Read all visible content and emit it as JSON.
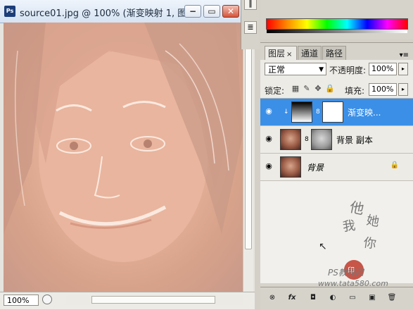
{
  "document": {
    "title": "source01.jpg @ 100% (渐变映射 1, 图...",
    "zoom": "100%",
    "app_icon": "Ps"
  },
  "window_buttons": {
    "minimize": "−",
    "restore": "▭",
    "close": "✕"
  },
  "layers_panel": {
    "tabs": [
      {
        "label": "图层",
        "close": "×"
      },
      {
        "label": "通道"
      },
      {
        "label": "路径"
      }
    ],
    "blend_mode": "正常",
    "opacity_label": "不透明度:",
    "opacity_value": "100%",
    "lock_label": "锁定:",
    "fill_label": "填充:",
    "fill_value": "100%",
    "layers": [
      {
        "name": "渐变映...",
        "selected": true
      },
      {
        "name": "背景 副本",
        "selected": false
      },
      {
        "name": "背景",
        "selected": false,
        "locked": true
      }
    ],
    "watermark_text": "他她我你",
    "site_text": "PS教程网",
    "url_text": "www.tata580.com"
  },
  "icons": {
    "eye": "eye-icon",
    "chain": "chain-link-icon",
    "lock": "lock-icon",
    "link": "link-layers-icon",
    "fx": "fx-icon",
    "mask": "add-mask-icon",
    "adjust": "adjustment-layer-icon",
    "group": "folder-icon",
    "new": "new-layer-icon",
    "trash": "trash-icon"
  },
  "colors": {
    "selection": "#3b8fe6",
    "seal": "#c0392b"
  }
}
